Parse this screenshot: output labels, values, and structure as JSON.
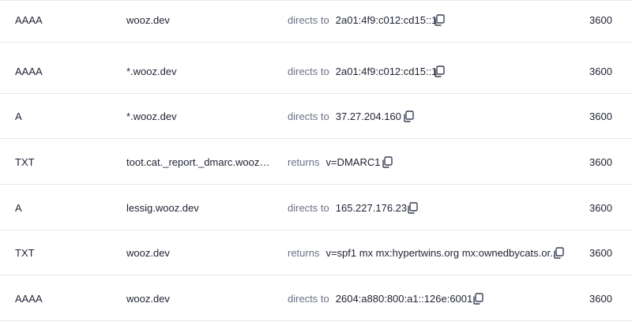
{
  "records": [
    {
      "type": "AAAA",
      "name": "wooz.dev",
      "verb": "directs to",
      "value": "2a01:4f9:c012:cd15::1",
      "ttl": "3600"
    },
    {
      "type": "AAAA",
      "name": "*.wooz.dev",
      "verb": "directs to",
      "value": "2a01:4f9:c012:cd15::1",
      "ttl": "3600"
    },
    {
      "type": "A",
      "name": "*.wooz.dev",
      "verb": "directs to",
      "value": "37.27.204.160",
      "ttl": "3600"
    },
    {
      "type": "TXT",
      "name": "toot.cat._report._dmarc.wooz.d...",
      "verb": "returns",
      "value": "v=DMARC1",
      "ttl": "3600"
    },
    {
      "type": "A",
      "name": "lessig.wooz.dev",
      "verb": "directs to",
      "value": "165.227.176.23",
      "ttl": "3600"
    },
    {
      "type": "TXT",
      "name": "wooz.dev",
      "verb": "returns",
      "value": "v=spf1 mx mx:hypertwins.org mx:ownedbycats.or...",
      "ttl": "3600"
    },
    {
      "type": "AAAA",
      "name": "wooz.dev",
      "verb": "directs to",
      "value": "2604:a880:800:a1::126e:6001",
      "ttl": "3600"
    }
  ],
  "icons": {
    "copy": "copy-icon"
  },
  "colors": {
    "text": "#1f2233",
    "muted": "#6b7185",
    "divider": "#e6e8ee"
  }
}
